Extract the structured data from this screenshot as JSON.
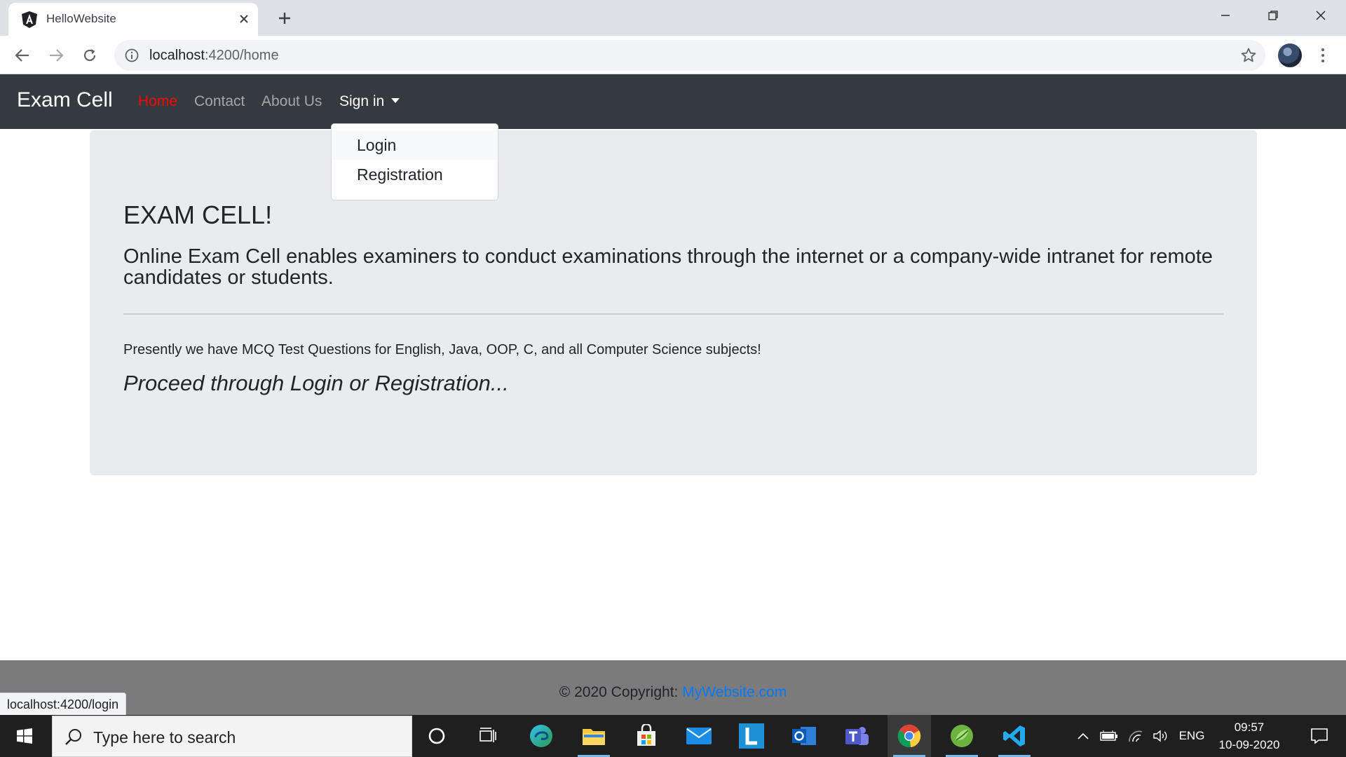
{
  "browser": {
    "tab_title": "HelloWebsite",
    "url_host": "localhost",
    "url_rest": ":4200/home",
    "status_url": "localhost:4200/login"
  },
  "navbar": {
    "brand": "Exam Cell",
    "links": [
      {
        "label": "Home"
      },
      {
        "label": "Contact"
      },
      {
        "label": "About Us"
      },
      {
        "label": "Sign in"
      }
    ],
    "active_color": "#ff0000",
    "background": "#343a40"
  },
  "dropdown": {
    "items": [
      {
        "label": "Login"
      },
      {
        "label": "Registration"
      }
    ]
  },
  "jumbotron": {
    "title": "EXAM CELL!",
    "lead": "Online Exam Cell enables examiners to conduct examinations through the internet or a company-wide intranet for remote candidates or students.",
    "text": "Presently we have MCQ Test Questions for English, Java, OOP, C, and all Computer Science subjects!",
    "italic": "Proceed through Login or Registration..."
  },
  "footer": {
    "copyright": "© 2020 Copyright: ",
    "link": "MyWebsite.com",
    "link_color": "#007bff"
  },
  "taskbar": {
    "search_placeholder": "Type here to search",
    "language": "ENG",
    "time": "09:57",
    "date": "10-09-2020",
    "apps": [
      {
        "icon": "cortana-icon"
      },
      {
        "icon": "task-view-icon"
      },
      {
        "icon": "edge-icon"
      },
      {
        "icon": "file-explorer-icon"
      },
      {
        "icon": "microsoft-store-icon"
      },
      {
        "icon": "mail-icon"
      },
      {
        "icon": "l-app-icon"
      },
      {
        "icon": "outlook-icon"
      },
      {
        "icon": "teams-icon"
      },
      {
        "icon": "chrome-icon"
      },
      {
        "icon": "spring-tool-icon"
      },
      {
        "icon": "vscode-icon"
      }
    ]
  }
}
